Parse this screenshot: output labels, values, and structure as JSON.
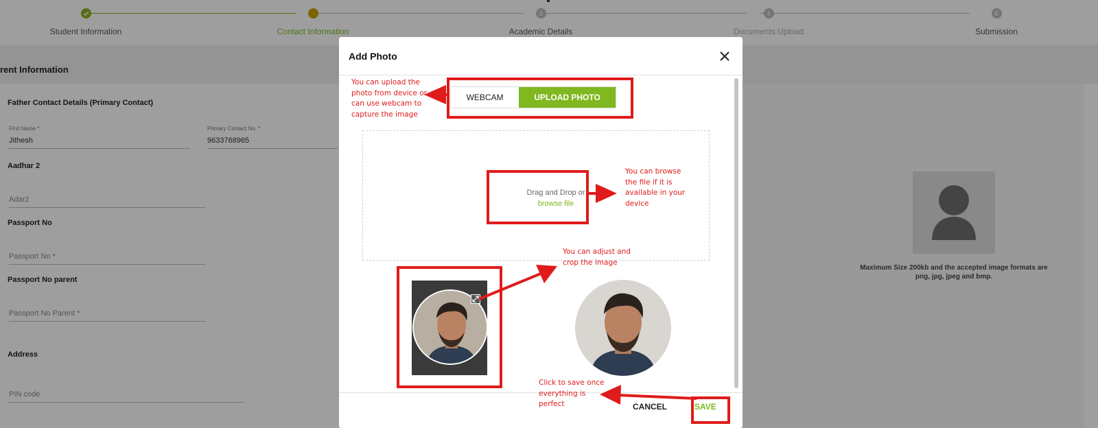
{
  "stepper": {
    "steps": [
      {
        "label": "Student Information",
        "marker": "check-icon",
        "status": "done"
      },
      {
        "label": "Contact Information",
        "marker": "",
        "status": "current"
      },
      {
        "label": "Academic Details",
        "marker": "3",
        "status": "pending"
      },
      {
        "label": "Documents Upload",
        "marker": "4",
        "status": "pending"
      },
      {
        "label": "Submission",
        "marker": "5",
        "status": "pending"
      }
    ],
    "done_color": "#8ab41d",
    "current_color": "#c9a100",
    "pending_color": "#bdbdbd"
  },
  "form": {
    "section_title": "rent Information",
    "father_heading": "Father Contact Details (Primary Contact)",
    "first_name": {
      "label": "First Name *",
      "value": "Jithesh"
    },
    "primary_contact": {
      "label": "Primary Contact No. *",
      "value": "9633768965"
    },
    "aadhar_heading": "Aadhar 2",
    "aadhar_value": "Adar2",
    "passport_heading": "Passport No",
    "passport_placeholder": "Passport No *",
    "passport_parent_heading": "Passport No parent",
    "passport_parent_placeholder": "Passport No Parent *",
    "address_heading": "Address",
    "pin_placeholder": "PIN code"
  },
  "photo_panel": {
    "avatar_icon": "user-silhouette-icon",
    "note": "Maximum Size 200kb and the accepted image formats are png, jpg, jpeg and bmp."
  },
  "modal": {
    "title": "Add Photo",
    "close_icon": "close-icon",
    "tabs": {
      "webcam": "WEBCAM",
      "upload": "UPLOAD PHOTO"
    },
    "dropzone": {
      "text": "Drag and Drop or",
      "link": "browse file"
    },
    "crop_handle_icon": "resize-icon",
    "cancel_label": "CANCEL",
    "save_label": "SAVE",
    "accent": "#7fb81f"
  },
  "annotations": {
    "upload_note": "You can upload the photo from device or can use webcam to capture the image",
    "browse_note": "You can browse the file if it is available in your device",
    "crop_note": "You can adjust and crop the image",
    "save_note": "Click to save once everything is perfect",
    "color": "#e01b1b"
  }
}
